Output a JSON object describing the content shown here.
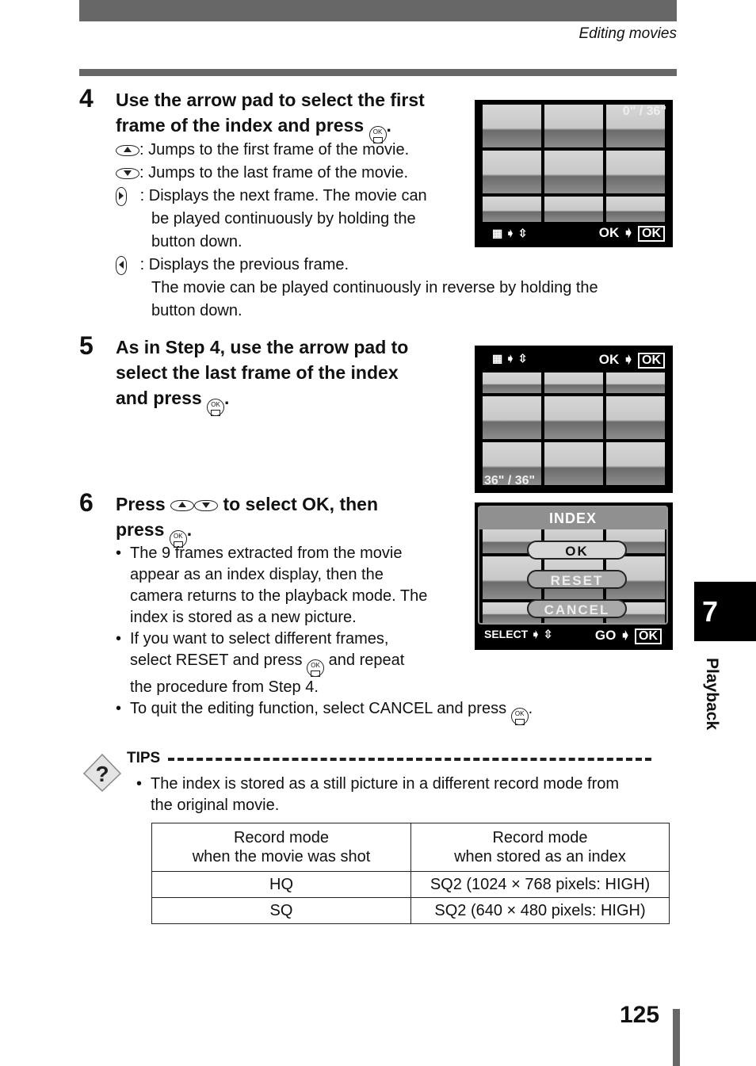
{
  "header": {
    "section_title": "Editing movies"
  },
  "steps": [
    {
      "number": "4",
      "heading": [
        "Use the arrow pad to select the first",
        "frame of the index and press",
        "."
      ],
      "items": [
        {
          "icon": "arrow-pad-up-icon",
          "text": ": Jumps to the first frame of the movie."
        },
        {
          "icon": "arrow-pad-down-icon",
          "text": ": Jumps to the last frame of the movie."
        },
        {
          "icon": "arrow-pad-right-icon",
          "text": ": Displays the next frame. The movie can",
          "cont": [
            "be played continuously by holding the",
            "button down."
          ]
        },
        {
          "icon": "arrow-pad-left-icon",
          "text": ": Displays the previous frame.",
          "cont": [
            "The movie can be played continuously in reverse by holding the",
            "button down."
          ]
        }
      ],
      "screen": {
        "counter": "0\" /  36\"",
        "ok_label": "OK",
        "ok_box": "OK"
      }
    },
    {
      "number": "5",
      "heading": [
        "As in Step 4, use the arrow pad to",
        "select the last frame of the index",
        "and press",
        "."
      ],
      "screen": {
        "counter": "36\" /  36\"",
        "ok_label": "OK",
        "ok_box": "OK"
      }
    },
    {
      "number": "6",
      "heading": [
        "Press",
        "to select OK, then",
        "press",
        "."
      ],
      "bullets": [
        [
          "The 9 frames extracted from the movie",
          "appear as an index display, then the",
          "camera returns to the playback mode. The",
          "index is stored as a new picture."
        ],
        [
          "If you want to select different frames,",
          "select RESET and press",
          "and repeat",
          "the procedure from Step 4."
        ],
        [
          "To quit the editing function, select CANCEL and press",
          "."
        ]
      ],
      "screen": {
        "menu_title": "INDEX",
        "options": [
          "OK",
          "RESET",
          "CANCEL"
        ],
        "selected": "OK",
        "select_label": "SELECT",
        "go_label": "GO",
        "ok_box": "OK"
      }
    }
  ],
  "tips": {
    "label": "TIPS",
    "text": [
      "The index is stored as a still picture in a different record mode from",
      "the original movie."
    ],
    "table": {
      "headers": [
        [
          "Record mode",
          "when the movie was shot"
        ],
        [
          "Record mode",
          "when stored as an index"
        ]
      ],
      "rows": [
        [
          "HQ",
          "SQ2 (1024 × 768 pixels: HIGH)"
        ],
        [
          "SQ",
          "SQ2 (640 × 480 pixels: HIGH)"
        ]
      ]
    }
  },
  "side_tab": {
    "chapter": "7",
    "label": "Playback"
  },
  "footer": {
    "page_number": "125"
  }
}
